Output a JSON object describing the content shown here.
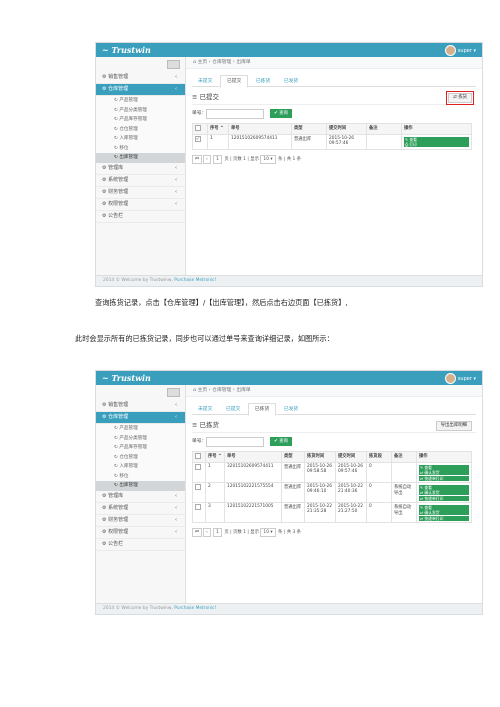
{
  "screenshot1": {
    "brand": "Trustwin",
    "user": "super",
    "sidebar": [
      {
        "label": "销售管理",
        "expanded": false
      },
      {
        "label": "仓库管理",
        "expanded": true
      },
      {
        "label": "产品管理",
        "sub": true
      },
      {
        "label": "产品分类管理",
        "sub": true
      },
      {
        "label": "产品库存管理",
        "sub": true
      },
      {
        "label": "仓位管理",
        "sub": true
      },
      {
        "label": "入库管理",
        "sub": true
      },
      {
        "label": "移位",
        "sub": true
      },
      {
        "label": "出库管理",
        "sub": true,
        "active": true
      },
      {
        "label": "管理库",
        "expanded": false
      },
      {
        "label": "系统管理",
        "expanded": false
      },
      {
        "label": "财务管理",
        "expanded": false
      },
      {
        "label": "权限管理",
        "expanded": false
      },
      {
        "label": "公告栏",
        "expanded": false
      }
    ],
    "breadcrumb": [
      "主页",
      "仓库管理",
      "出库单"
    ],
    "tabs": [
      "未提交",
      "已提交",
      "已拣货",
      "已发货"
    ],
    "active_tab": 1,
    "panel_title": "已提交",
    "panel_button": "拣货",
    "search_label": "单号：",
    "search_button": "查询",
    "columns": [
      "序号",
      "单号",
      "类型",
      "提交时间",
      "备注",
      "操作"
    ],
    "rows": [
      {
        "no": "1",
        "order": "12015102609574411",
        "type": "普通出库",
        "time": "2015-10-26 09:57:46",
        "note": "",
        "actions": [
          "查看",
          "打印"
        ]
      }
    ],
    "pager": {
      "page": "1",
      "text1": "页 | 页数 1 | 显示",
      "size": "10",
      "text2": "条 | 共 1 条"
    },
    "footer_text": "2014 © Welcome by Trustwinw,",
    "footer_link": "Purchase Metronic!"
  },
  "para1": "查询拣货记录，点击【仓库管理】/【出库管理】，然后点击右边页面【已拣货】,",
  "para2": "此时会显示所有的已拣货记录，同步也可以通过单号来查询详细记录，如图所示：",
  "screenshot2": {
    "brand": "Trustwin",
    "user": "super",
    "sidebar": [
      {
        "label": "销售管理",
        "expanded": false
      },
      {
        "label": "仓库管理",
        "expanded": true
      },
      {
        "label": "产品管理",
        "sub": true
      },
      {
        "label": "产品分类管理",
        "sub": true
      },
      {
        "label": "产品库存管理",
        "sub": true
      },
      {
        "label": "仓位管理",
        "sub": true
      },
      {
        "label": "入库管理",
        "sub": true
      },
      {
        "label": "移位",
        "sub": true
      },
      {
        "label": "出库管理",
        "sub": true,
        "active": true
      },
      {
        "label": "管理库",
        "expanded": false
      },
      {
        "label": "系统管理",
        "expanded": false
      },
      {
        "label": "财务管理",
        "expanded": false
      },
      {
        "label": "权限管理",
        "expanded": false
      },
      {
        "label": "公告栏",
        "expanded": false
      }
    ],
    "breadcrumb": [
      "主页",
      "仓库管理",
      "出库单"
    ],
    "tabs": [
      "未提交",
      "已提交",
      "已拣货",
      "已发货"
    ],
    "active_tab": 2,
    "panel_title": "已拣货",
    "panel_button": "导出出库明细",
    "search_label": "单号：",
    "search_button": "查询",
    "columns": [
      "序号",
      "单号",
      "类型",
      "拣货时间",
      "提交时间",
      "拣货段",
      "备注",
      "操作"
    ],
    "rows": [
      {
        "no": "1",
        "order": "32015102609574411",
        "type": "普通出库",
        "pick": "2015-10-26 09:58:58",
        "time": "2015-10-26 09:57:46",
        "seg": "0",
        "note": "",
        "actions": [
          "查看",
          "确认发货",
          "快递单打印"
        ]
      },
      {
        "no": "2",
        "order": "12015102221575554",
        "type": "普通出库",
        "pick": "2015-10-26 09:46:10",
        "time": "2015-10-22 21:40:36",
        "seg": "0",
        "note": "系统自动导出",
        "actions": [
          "查看",
          "确认发货",
          "快递单打印"
        ]
      },
      {
        "no": "3",
        "order": "12015102221571005",
        "type": "普通出库",
        "pick": "2015-10-22 21:35:28",
        "time": "2015-10-22 21:27:50",
        "seg": "0",
        "note": "系统自动导出",
        "actions": [
          "查看",
          "确认发货",
          "快递单打印"
        ]
      }
    ],
    "pager": {
      "page": "1",
      "text1": "页 | 页数 1 | 显示",
      "size": "10",
      "text2": "条 | 共 3 条"
    },
    "footer_text": "2014 © Welcome by Trustwinw,",
    "footer_link": "Purchase Metronic!"
  }
}
